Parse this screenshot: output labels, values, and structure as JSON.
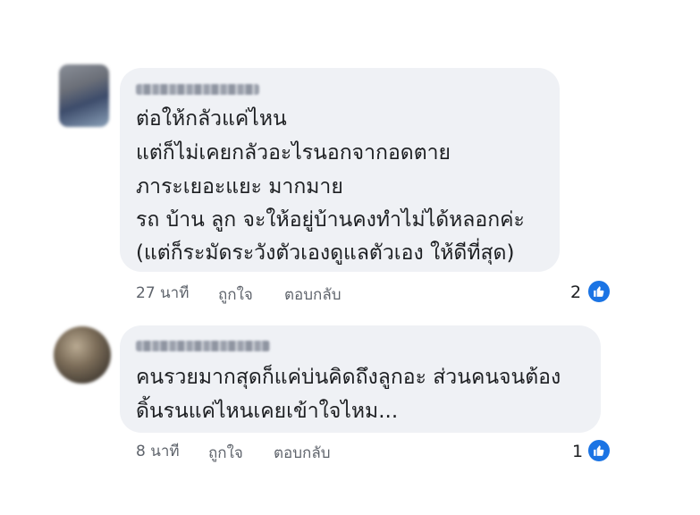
{
  "comments": [
    {
      "lines": [
        "ต่อให้กลัวแค่ไหน",
        "แต่ก็ไม่เคยกลัวอะไรนอกจากอดตาย",
        "ภาระเยอะแยะ มากมาย",
        "รถ บ้าน ลูก จะให้อยู่บ้านคงทำไม่ได้หลอกค่ะ",
        "(แต่ก็ระมัดระวังตัวเองดูแลตัวเอง ให้ดีที่สุด)"
      ],
      "time": "27 นาที",
      "like_label": "ถูกใจ",
      "reply_label": "ตอบกลับ",
      "reaction_count": "2"
    },
    {
      "lines": [
        "คนรวยมากสุดก็แค่บ่นคิดถึงลูกอะ ส่วนคนจนต้อง",
        "ดิ้นรนแค่ไหนเคยเข้าใจไหม..."
      ],
      "time": "8 นาที",
      "like_label": "ถูกใจ",
      "reply_label": "ตอบกลับ",
      "reaction_count": "1"
    }
  ],
  "colors": {
    "bubble_bg": "#eff1f5",
    "like_blue": "#1b74e4",
    "meta_text": "#5f646c"
  },
  "icons": {
    "reaction": "like-thumbs-up-icon"
  }
}
